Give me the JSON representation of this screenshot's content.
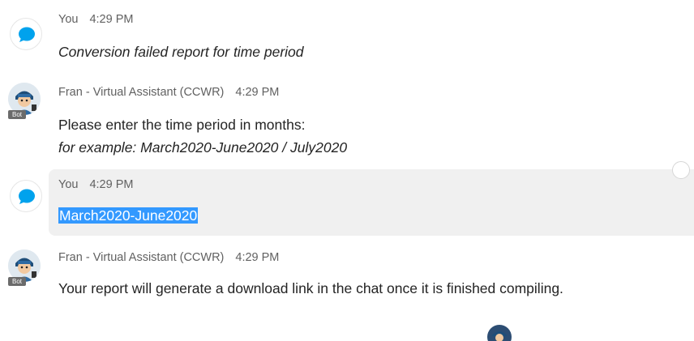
{
  "messages": [
    {
      "sender": "You",
      "time": "4:29 PM",
      "lines": [
        "Conversion failed report for time period"
      ]
    },
    {
      "sender": "Fran - Virtual Assistant (CCWR)",
      "time": "4:29 PM",
      "badge": "Bot",
      "lines": [
        "Please enter the time period in months:",
        "for example: March2020-June2020 / July2020"
      ]
    },
    {
      "sender": "You",
      "time": "4:29 PM",
      "lines": [
        "March2020-June2020"
      ]
    },
    {
      "sender": "Fran - Virtual Assistant (CCWR)",
      "time": "4:29 PM",
      "badge": "Bot",
      "lines": [
        "Your report will generate a download link in the chat once it is finished compiling."
      ]
    }
  ],
  "colors": {
    "user_icon": "#00a2ed",
    "selection": "#3399ff",
    "highlight_bg": "#f0f0f0"
  },
  "icons": {
    "user_avatar": "chat-bubble-icon",
    "bot_avatar": "bot-character-icon"
  }
}
